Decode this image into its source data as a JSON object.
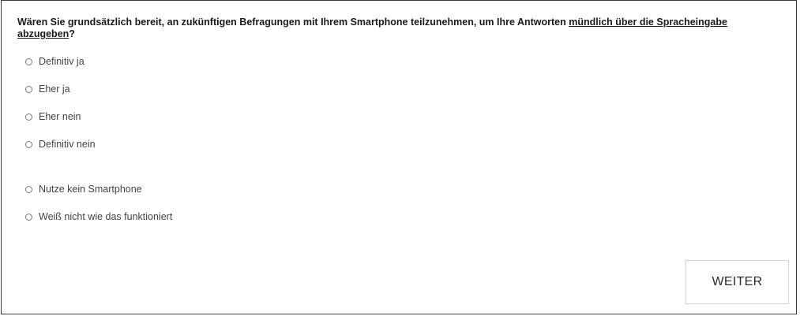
{
  "question": {
    "part1": "Wären Sie grundsätzlich bereit, an zukünftigen Befragungen mit Ihrem Smartphone teilzunehmen, um Ihre Antworten ",
    "underlined": "mündlich über die Spracheingabe abzugeben",
    "part2": "?"
  },
  "options": [
    {
      "label": "Definitiv ja",
      "selected": false
    },
    {
      "label": "Eher ja",
      "selected": false
    },
    {
      "label": "Eher nein",
      "selected": false
    },
    {
      "label": "Definitiv nein",
      "selected": false
    },
    {
      "label": "Nutze kein Smartphone",
      "selected": false
    },
    {
      "label": "Weiß nicht wie das funktioniert",
      "selected": false
    }
  ],
  "next_button": {
    "label": "WEITER"
  }
}
